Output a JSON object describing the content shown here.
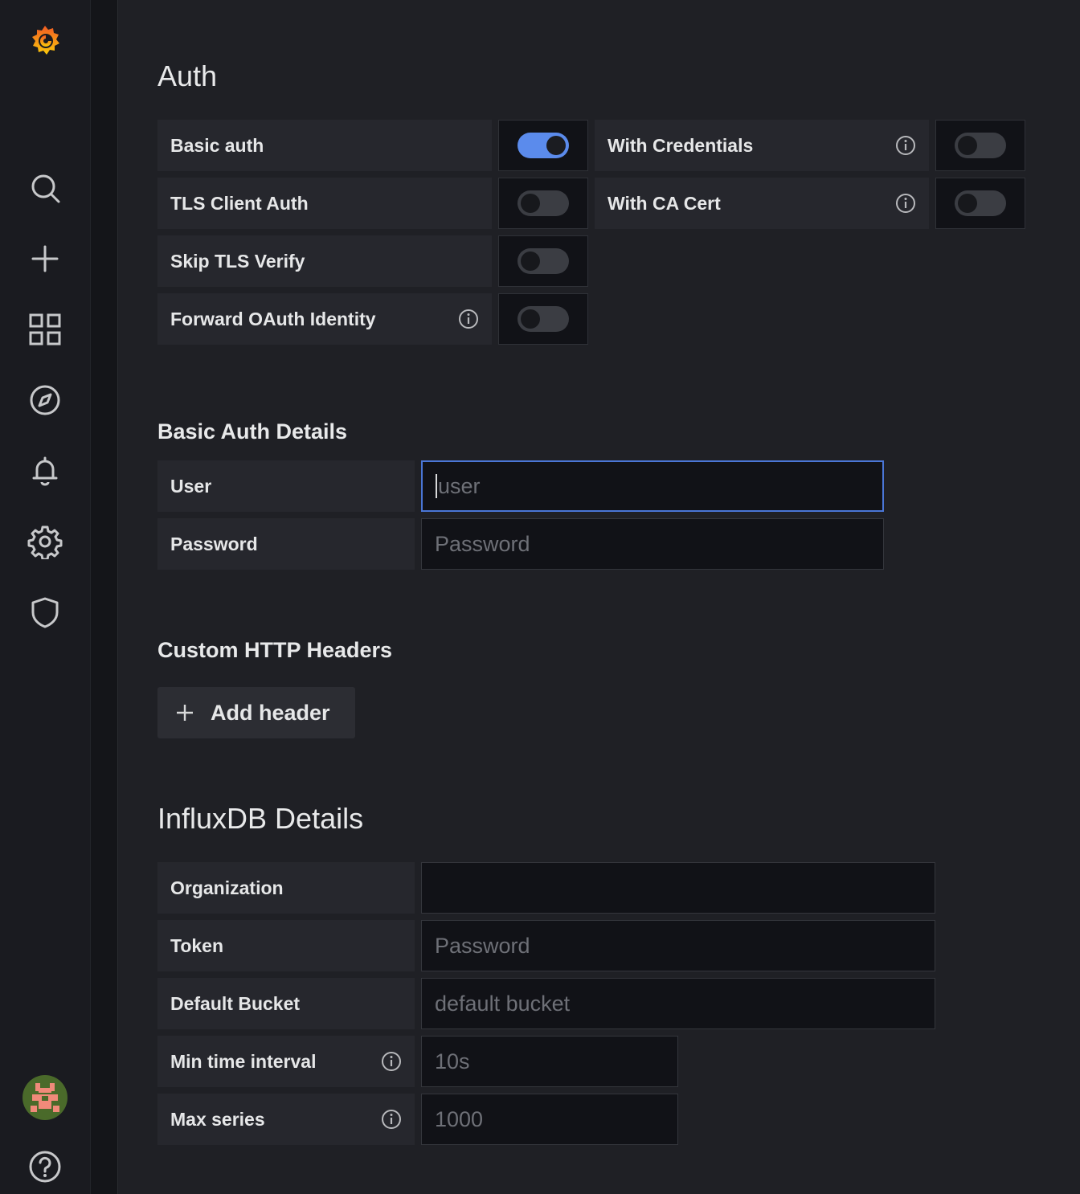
{
  "nav": {
    "items": [
      {
        "icon": "search-icon"
      },
      {
        "icon": "plus-icon"
      },
      {
        "icon": "dashboards-icon"
      },
      {
        "icon": "explore-compass-icon"
      },
      {
        "icon": "alerting-bell-icon"
      },
      {
        "icon": "configuration-gear-icon"
      },
      {
        "icon": "server-admin-shield-icon"
      }
    ],
    "bottom": [
      {
        "icon": "user-avatar"
      },
      {
        "icon": "help-icon"
      }
    ]
  },
  "auth": {
    "title": "Auth",
    "switches": [
      {
        "label": "Basic auth",
        "on": true,
        "info": false
      },
      {
        "label": "With Credentials",
        "on": false,
        "info": true
      },
      {
        "label": "TLS Client Auth",
        "on": false,
        "info": false
      },
      {
        "label": "With CA Cert",
        "on": false,
        "info": true
      },
      {
        "label": "Skip TLS Verify",
        "on": false,
        "info": false
      },
      {
        "label": "Forward OAuth Identity",
        "on": false,
        "info": true
      }
    ]
  },
  "basic_auth": {
    "title": "Basic Auth Details",
    "user_label": "User",
    "user_placeholder": "user",
    "password_label": "Password",
    "password_placeholder": "Password"
  },
  "headers": {
    "title": "Custom HTTP Headers",
    "add_label": "Add header"
  },
  "influx": {
    "title": "InfluxDB Details",
    "org_label": "Organization",
    "org_value": "",
    "token_label": "Token",
    "token_placeholder": "Password",
    "bucket_label": "Default Bucket",
    "bucket_placeholder": "default bucket",
    "min_label": "Min time interval",
    "min_placeholder": "10s",
    "max_label": "Max series",
    "max_placeholder": "1000"
  },
  "colors": {
    "accent": "#5b8bec",
    "logo": "#f46800"
  }
}
